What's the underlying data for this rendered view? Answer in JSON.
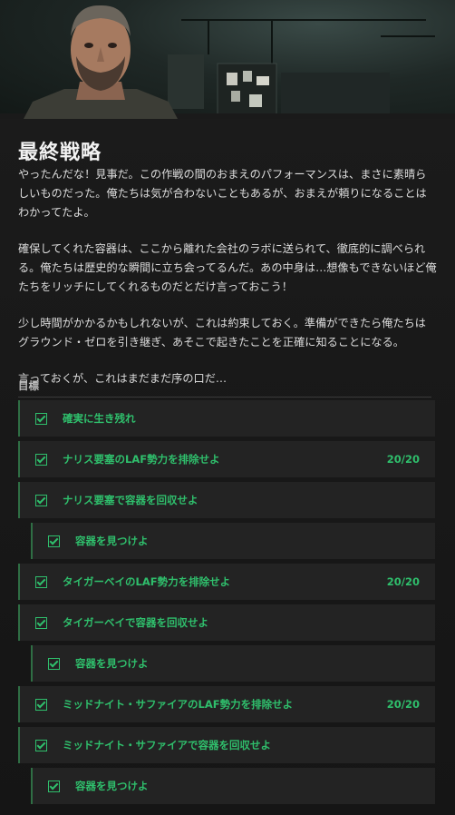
{
  "page": {
    "title": "最終戦略",
    "briefing": [
      "やったんだな！見事だ。この作戦の間のおまえのパフォーマンスは、まさに素晴らしいものだった。俺たちは気が合わないこともあるが、おまえが頼りになることはわかってたよ。",
      "確保してくれた容器は、ここから離れた会社のラボに送られて、徹底的に調べられる。俺たちは歴史的な瞬間に立ち会ってるんだ。あの中身は…想像もできないほど俺たちをリッチにしてくれるものだとだけ言っておこう！",
      "少し時間がかかるかもしれないが、これは約束しておく。準備ができたら俺たちはグラウンド・ゼロを引き継ぎ、あそこで起きたことを正確に知ることになる。",
      "言っておくが、これはまだまだ序の口だ…"
    ]
  },
  "objectives": {
    "header": "目標",
    "items": [
      {
        "label": "確実に生き残れ",
        "count": ""
      },
      {
        "label": "ナリス要塞のLAF勢力を排除せよ",
        "count": "20/20"
      },
      {
        "label": "ナリス要塞で容器を回収せよ",
        "count": ""
      },
      {
        "label": "容器を見つけよ",
        "count": ""
      },
      {
        "label": "タイガーベイのLAF勢力を排除せよ",
        "count": "20/20"
      },
      {
        "label": "タイガーベイで容器を回収せよ",
        "count": ""
      },
      {
        "label": "容器を見つけよ",
        "count": ""
      },
      {
        "label": "ミッドナイト・サファイアのLAF勢力を排除せよ",
        "count": "20/20"
      },
      {
        "label": "ミッドナイト・サファイアで容器を回収せよ",
        "count": ""
      },
      {
        "label": "容器を見つけよ",
        "count": ""
      }
    ]
  },
  "colors": {
    "accent": "#2fbf6c",
    "row_bg": "#232323",
    "panel_bg": "#181818"
  }
}
